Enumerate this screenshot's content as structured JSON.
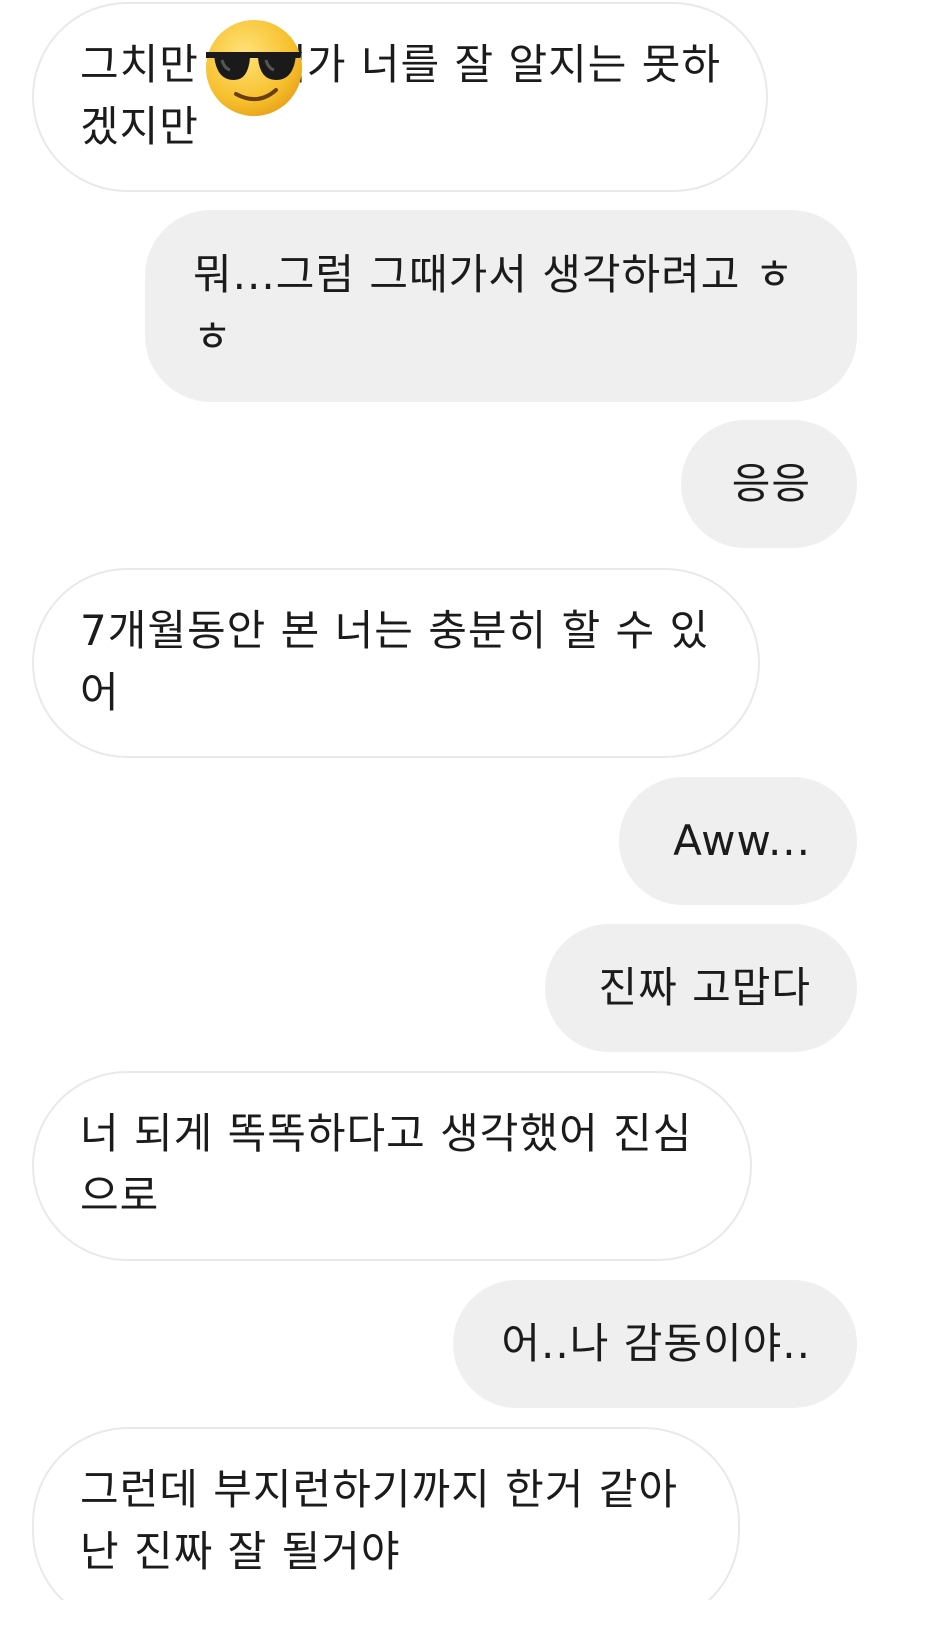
{
  "messages": [
    {
      "side": "received",
      "text": "그치만 아 내가 너를 잘 알지는 못하겠지만"
    },
    {
      "side": "sent",
      "text": "뭐...그럼 그때가서 생각하려고 ㅎㅎ"
    },
    {
      "side": "sent",
      "text": "응응"
    },
    {
      "side": "received",
      "text": "7개월동안 본 너는 충분히 할 수 있어"
    },
    {
      "side": "sent",
      "text": "Aww..."
    },
    {
      "side": "sent",
      "text": "진짜 고맙다"
    },
    {
      "side": "received",
      "text": "너 되게 똑똑하다고 생각했어 진심으로"
    },
    {
      "side": "sent",
      "text": "어..나 감동이야.."
    },
    {
      "side": "received",
      "text": "그런데 부지런하기까지 한거 같아 난 진짜 잘 될거야"
    }
  ],
  "sticker": {
    "icon": "sunglasses-emoji-icon"
  },
  "colors": {
    "sent_bubble": "#efefef",
    "received_border": "#e9e9e9",
    "text": "#1b1b1b",
    "background": "#ffffff"
  }
}
